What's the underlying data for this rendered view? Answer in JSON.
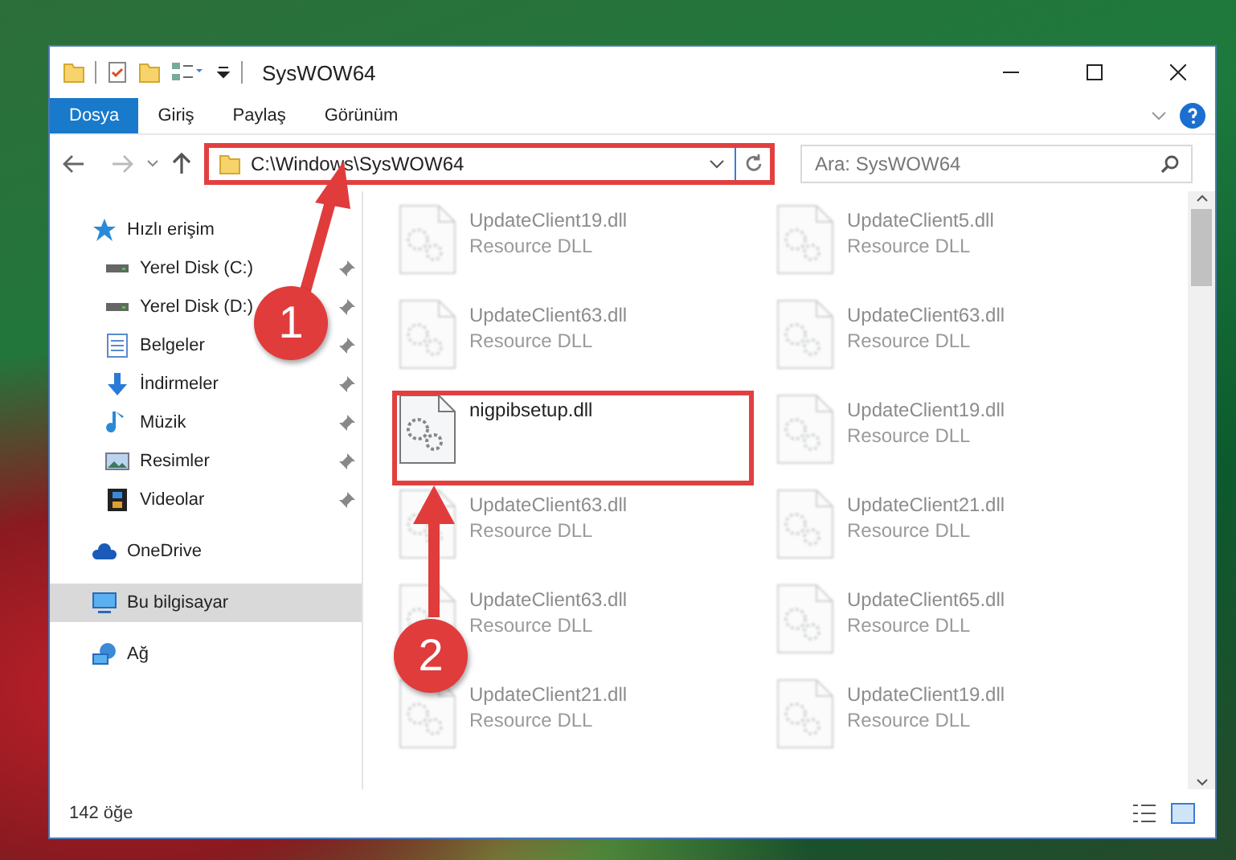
{
  "window": {
    "title": "SysWOW64"
  },
  "ribbon_tabs": [
    {
      "label": "Dosya",
      "selected": true
    },
    {
      "label": "Giriş",
      "selected": false
    },
    {
      "label": "Paylaş",
      "selected": false
    },
    {
      "label": "Görünüm",
      "selected": false
    }
  ],
  "address": {
    "path": "C:\\Windows\\SysWOW64",
    "highlighted": true
  },
  "search": {
    "placeholder": "Ara: SysWOW64"
  },
  "sidebar": {
    "items": [
      {
        "label": "Hızlı erişim",
        "kind": "star",
        "selected": false,
        "children": [
          {
            "label": "Yerel Disk (C:)",
            "kind": "drive",
            "pinned": true,
            "selected": false
          },
          {
            "label": "Yerel Disk (D:)",
            "kind": "drive",
            "pinned": true,
            "selected": false
          },
          {
            "label": "Belgeler",
            "kind": "document",
            "pinned": true,
            "selected": false
          },
          {
            "label": "İndirmeler",
            "kind": "download",
            "pinned": true,
            "selected": false
          },
          {
            "label": "Müzik",
            "kind": "music",
            "pinned": true,
            "selected": false
          },
          {
            "label": "Resimler",
            "kind": "pictures",
            "pinned": true,
            "selected": false
          },
          {
            "label": "Videolar",
            "kind": "video",
            "pinned": true,
            "selected": false
          }
        ]
      },
      {
        "label": "OneDrive",
        "kind": "cloud",
        "selected": false
      },
      {
        "label": "Bu bilgisayar",
        "kind": "computer",
        "selected": true
      },
      {
        "label": "Ağ",
        "kind": "network",
        "selected": false
      }
    ]
  },
  "files": [
    {
      "name": "UpdateClient19.dll",
      "type": "Resource DLL",
      "blurred": true,
      "highlighted": false
    },
    {
      "name": "UpdateClient5.dll",
      "type": "Resource DLL",
      "blurred": true,
      "highlighted": false
    },
    {
      "name": "UpdateClient63.dll",
      "type": "Resource DLL",
      "blurred": true,
      "highlighted": false
    },
    {
      "name": "UpdateClient63.dll",
      "type": "Resource DLL",
      "blurred": true,
      "highlighted": false
    },
    {
      "name": "nigpibsetup.dll",
      "blurred": false,
      "highlighted": true
    },
    {
      "name": "UpdateClient19.dll",
      "type": "Resource DLL",
      "blurred": true,
      "highlighted": false
    },
    {
      "name": "UpdateClient63.dll",
      "type": "Resource DLL",
      "blurred": true,
      "highlighted": false
    },
    {
      "name": "UpdateClient21.dll",
      "type": "Resource DLL",
      "blurred": true,
      "highlighted": false
    },
    {
      "name": "UpdateClient63.dll",
      "type": "Resource DLL",
      "blurred": true,
      "highlighted": false
    },
    {
      "name": "UpdateClient65.dll",
      "type": "Resource DLL",
      "blurred": true,
      "highlighted": false
    },
    {
      "name": "UpdateClient21.dll",
      "type": "Resource DLL",
      "blurred": true,
      "highlighted": false
    },
    {
      "name": "UpdateClient19.dll",
      "type": "Resource DLL",
      "blurred": true,
      "highlighted": false
    }
  ],
  "status_bar": {
    "count": "142 öğe"
  },
  "callouts": [
    {
      "number": "1"
    },
    {
      "number": "2"
    }
  ]
}
